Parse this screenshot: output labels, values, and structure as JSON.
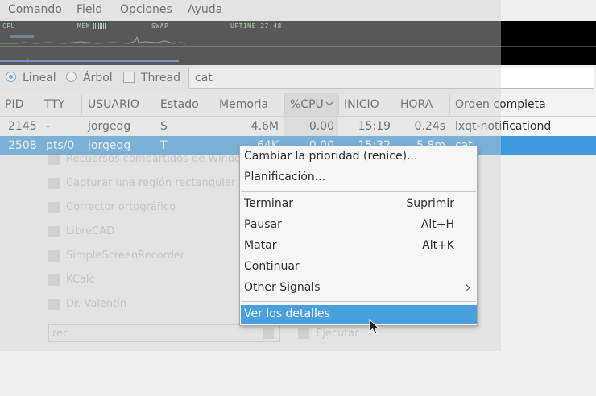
{
  "menubar": {
    "items": [
      "Comando",
      "Field",
      "Opciones",
      "Ayuda"
    ]
  },
  "graph": {
    "cpu": "CPU",
    "mem": "MEM",
    "swap": "SWAP",
    "uptime": "UPTIME 27:48"
  },
  "view": {
    "lineal": "Lineal",
    "arbol": "Árbol",
    "thread": "Thread",
    "filter_value": "cat"
  },
  "table": {
    "columns": [
      "PID",
      "TTY",
      "USUARIO",
      "Estado",
      "Memoria",
      "%CPU",
      "INICIO",
      "HORA",
      "Orden completa"
    ],
    "rows": [
      {
        "pid": "2145",
        "tty": "-",
        "user": "jorgeqg",
        "state": "S",
        "mem": "4.6M",
        "cpu": "0.00",
        "start": "15:19",
        "time": "0.24s",
        "cmd": "lxqt-notificationd"
      },
      {
        "pid": "2508",
        "tty": "pts/0",
        "user": "jorgeqg",
        "state": "T",
        "mem": "64K",
        "cpu": "0.00",
        "start": "15:32",
        "time": "5.8m",
        "cmd": "cat"
      }
    ]
  },
  "ghost": {
    "items": [
      "Recuersos compartidos de Windows",
      "Capturar una región rectangular",
      "Corrector ortográfico",
      "LibreCAD",
      "SimpleScreenRecorder",
      "KCalc",
      "Dr. Valentín"
    ],
    "search_value": "rec",
    "run_label": "Ejecutar"
  },
  "context_menu": {
    "renice": "Cambiar la prioridad (renice)...",
    "schedule": "Planificación...",
    "terminate": "Terminar",
    "terminate_key": "Suprimir",
    "pause": "Pausar",
    "pause_key": "Alt+H",
    "kill": "Matar",
    "kill_key": "Alt+K",
    "continue": "Continuar",
    "other": "Other Signals",
    "details": "Ver los detalles"
  },
  "colors": {
    "selection": "#3d99db",
    "menu_highlight": "#4aa0dc",
    "graph_bg": "#000000",
    "graph_line": "#3fa23f"
  }
}
